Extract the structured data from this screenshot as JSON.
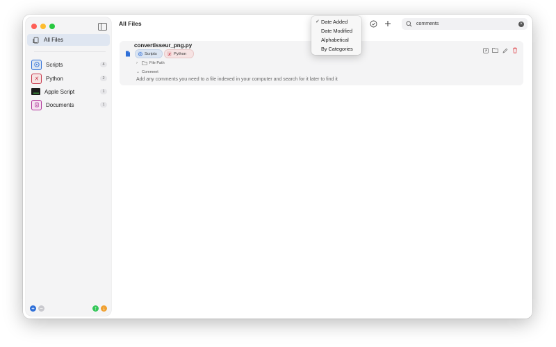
{
  "sidebar": {
    "all_files_label": "All Files",
    "categories": [
      {
        "label": "Scripts",
        "count": "4",
        "color": "#2e6fd8"
      },
      {
        "label": "Python",
        "count": "2",
        "color": "#c8364a"
      },
      {
        "label": "Apple Script",
        "count": "1",
        "color": "#1c1c1c"
      },
      {
        "label": "Documents",
        "count": "1",
        "color": "#b0339a"
      }
    ]
  },
  "main": {
    "title": "All Files",
    "search": {
      "value": "comments"
    }
  },
  "sort_menu": {
    "items": [
      {
        "label": "Date Added",
        "checked": true
      },
      {
        "label": "Date Modified",
        "checked": false
      },
      {
        "label": "Alphabetical",
        "checked": false
      },
      {
        "label": "By Categories",
        "checked": false
      }
    ],
    "check_mark": "✓"
  },
  "file": {
    "name": "convertisseur_png.py",
    "tags": [
      "Scripts",
      "Python"
    ],
    "file_path_label": "File Path",
    "comment_label": "Comment",
    "comment_text": "Add any comments you need to a file indexed in your computer and search for it later to find it"
  },
  "colors": {
    "accent": "#2e6fd8",
    "selected_row": "#dfe6f1",
    "delete": "#e0484f",
    "add_green": "#34c759",
    "add_orange": "#f0a030"
  }
}
